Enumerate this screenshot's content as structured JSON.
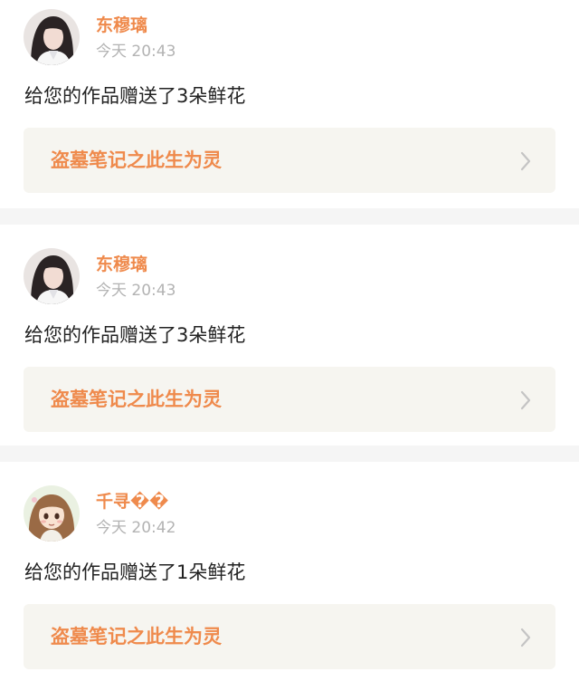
{
  "notifications": [
    {
      "username": "东穆璃",
      "time": "今天 20:43",
      "message": "给您的作品赠送了3朵鲜花",
      "work_title": "盗墓笔记之此生为灵",
      "avatar": "avatar-girl-dark-hair"
    },
    {
      "username": "东穆璃",
      "time": "今天 20:43",
      "message": "给您的作品赠送了3朵鲜花",
      "work_title": "盗墓笔记之此生为灵",
      "avatar": "avatar-girl-dark-hair"
    },
    {
      "username": "千寻��",
      "time": "今天 20:42",
      "message": "给您的作品赠送了1朵鲜花",
      "work_title": "盗墓笔记之此生为灵",
      "avatar": "avatar-anime-girl"
    }
  ],
  "colors": {
    "accent": "#ef8a4c",
    "link_bg": "#f6f5f0",
    "divider": "#f5f5f5",
    "muted": "#b3b3b3",
    "text": "#222222"
  }
}
